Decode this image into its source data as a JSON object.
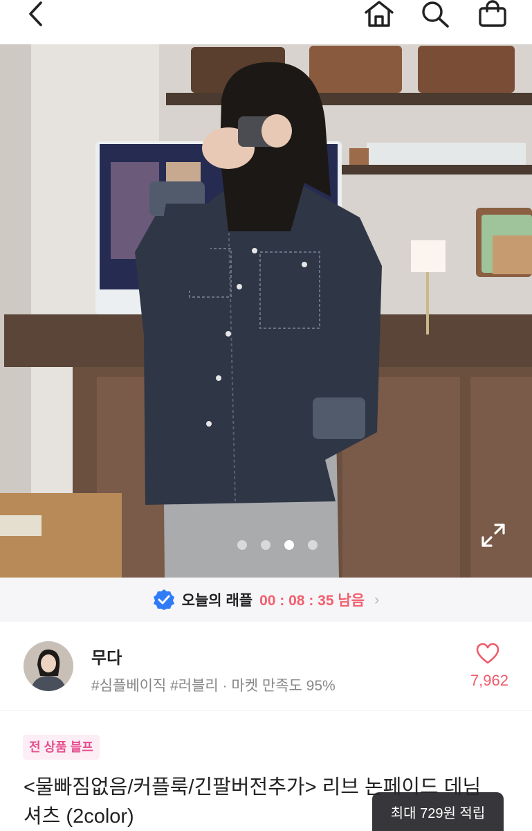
{
  "nav": {
    "back_icon": "chevron-left-icon",
    "home_icon": "home-icon",
    "search_icon": "search-icon",
    "bag_icon": "shopping-bag-icon"
  },
  "gallery": {
    "image_count": 4,
    "active_index": 2,
    "expand_icon": "expand-icon"
  },
  "raffle": {
    "icon": "verified-badge-icon",
    "label": "오늘의 래플",
    "timer": "00 : 08 : 35 남음",
    "chevron": "›"
  },
  "shop": {
    "name": "무다",
    "meta": "#심플베이직 #러블리 · 마켓 만족도 95%",
    "like_icon": "heart-icon",
    "like_count": "7,962"
  },
  "product": {
    "badge": "전 상품 블프",
    "title_line1": "<물빠짐없음/커플룩/긴팔버전추가> 리브 논페이드 데님",
    "title_line2": "셔츠 (2color)"
  },
  "toast": {
    "text": "최대 729원 적립"
  },
  "colors": {
    "accent_pink": "#f25f6e",
    "badge_pink": "#e64f8f",
    "verified_blue": "#2f7cf6"
  }
}
